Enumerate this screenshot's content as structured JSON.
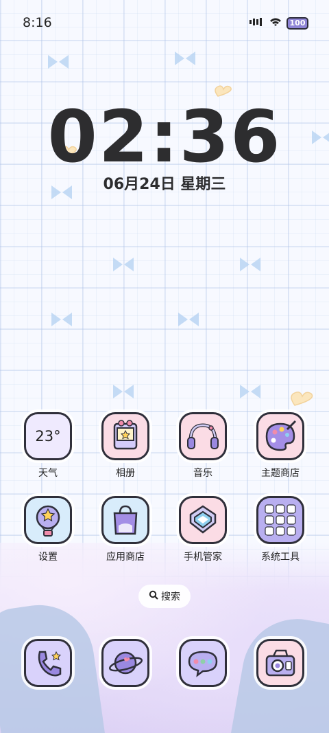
{
  "status_bar": {
    "time": "8:16",
    "battery": "100",
    "icons": [
      "vibrate-icon",
      "signal-icon",
      "wifi-icon",
      "battery-icon"
    ]
  },
  "clock": {
    "time": "02:36",
    "date": "06月24日 星期三"
  },
  "apps_row1": [
    {
      "label": "天气",
      "icon": "weather-icon",
      "value": "23°"
    },
    {
      "label": "相册",
      "icon": "photo-album-icon"
    },
    {
      "label": "音乐",
      "icon": "headphones-icon"
    },
    {
      "label": "主题商店",
      "icon": "palette-icon"
    }
  ],
  "apps_row2": [
    {
      "label": "设置",
      "icon": "hot-air-balloon-icon"
    },
    {
      "label": "应用商店",
      "icon": "shopping-bag-icon"
    },
    {
      "label": "手机管家",
      "icon": "shield-icon"
    },
    {
      "label": "系统工具",
      "icon": "folder-grid-icon"
    }
  ],
  "search": {
    "label": "搜索",
    "icon": "search-icon"
  },
  "dock": [
    {
      "icon": "phone-icon"
    },
    {
      "icon": "planet-icon"
    },
    {
      "icon": "message-bubble-icon"
    },
    {
      "icon": "camera-radio-icon"
    }
  ],
  "colors": {
    "icon_lavender": "#d9d2fb",
    "icon_pink": "#fbdce5",
    "icon_blue": "#d8ecfb",
    "accent_purple": "#9a88e0",
    "outline": "#2f2f3a"
  }
}
